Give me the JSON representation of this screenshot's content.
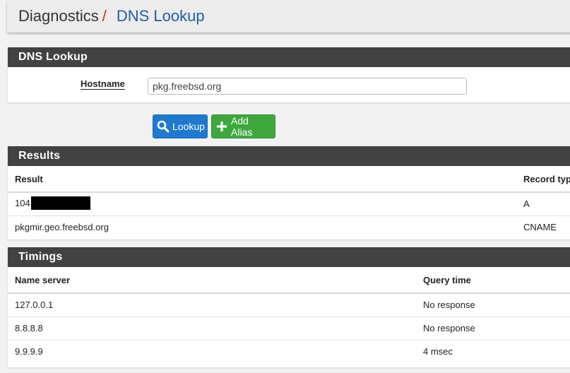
{
  "breadcrumb": {
    "root": "Diagnostics",
    "separator": "/",
    "current": "DNS Lookup"
  },
  "dns_panel": {
    "title": "DNS Lookup",
    "hostname_label": "Hostname",
    "hostname_value": "pkg.freebsd.org"
  },
  "buttons": {
    "lookup": "Lookup",
    "add_alias": "Add Alias"
  },
  "results": {
    "title": "Results",
    "columns": [
      "Result",
      "Record type"
    ],
    "rows": [
      {
        "result": "104",
        "type": "A"
      },
      {
        "result": "pkgmir.geo.freebsd.org",
        "type": "CNAME"
      }
    ]
  },
  "timings": {
    "title": "Timings",
    "columns": [
      "Name server",
      "Query time"
    ],
    "rows": [
      {
        "server": "127.0.0.1",
        "time": "No response"
      },
      {
        "server": "8.8.8.8",
        "time": "No response"
      },
      {
        "server": "9.9.9.9",
        "time": "4 msec"
      }
    ]
  },
  "colors": {
    "accent_blue": "#1e7ad0",
    "accent_green": "#3ea83e",
    "panel_heading": "#424242",
    "breadcrumb_sep": "#c9302c"
  }
}
